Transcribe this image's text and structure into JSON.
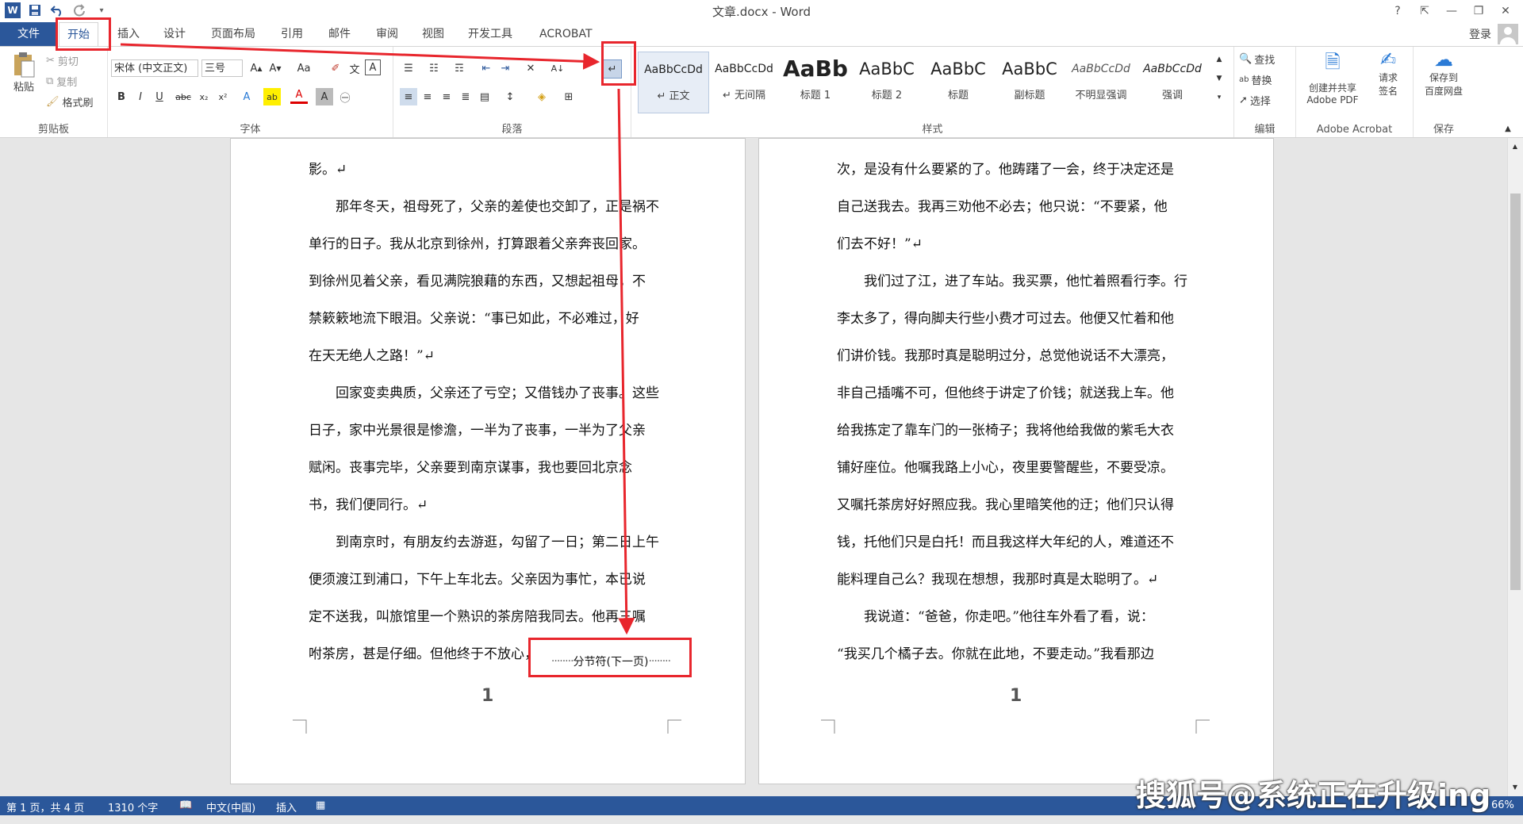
{
  "app": {
    "title": "文章.docx - Word",
    "login": "登录"
  },
  "window_controls": {
    "help": "?",
    "ribbon_display": "⇱",
    "minimize": "—",
    "restore": "❐",
    "close": "✕"
  },
  "tabs": [
    {
      "label": "文件"
    },
    {
      "label": "开始"
    },
    {
      "label": "插入"
    },
    {
      "label": "设计"
    },
    {
      "label": "页面布局"
    },
    {
      "label": "引用"
    },
    {
      "label": "邮件"
    },
    {
      "label": "审阅"
    },
    {
      "label": "视图"
    },
    {
      "label": "开发工具"
    },
    {
      "label": "ACROBAT"
    }
  ],
  "clipboard": {
    "paste": "粘贴",
    "cut": "剪切",
    "copy": "复制",
    "format_painter": "格式刷",
    "label": "剪贴板"
  },
  "font": {
    "name": "宋体 (中文正文)",
    "size": "三号",
    "label": "字体",
    "change_case": "Aa"
  },
  "paragraph": {
    "label": "段落"
  },
  "styles": {
    "label": "样式",
    "items": [
      {
        "preview": "AaBbCcDd",
        "name": "↵ 正文"
      },
      {
        "preview": "AaBbCcDd",
        "name": "↵ 无间隔"
      },
      {
        "preview": "AaBb",
        "name": "标题 1"
      },
      {
        "preview": "AaBbC",
        "name": "标题 2"
      },
      {
        "preview": "AaBbC",
        "name": "标题"
      },
      {
        "preview": "AaBbC",
        "name": "副标题"
      },
      {
        "preview": "AaBbCcDd",
        "name": "不明显强调"
      },
      {
        "preview": "AaBbCcDd",
        "name": "强调"
      }
    ]
  },
  "editing": {
    "find": "查找",
    "replace": "替换",
    "select": "选择",
    "label": "编辑"
  },
  "acrobat": {
    "create_share": "创建并共享",
    "adobe_pdf": "Adobe PDF",
    "request": "请求",
    "sign": "签名",
    "label": "Adobe Acrobat"
  },
  "save": {
    "save_to": "保存到",
    "baidu": "百度网盘",
    "label": "保存"
  },
  "page1": {
    "lines": [
      "影。↵",
      "　　那年冬天，祖母死了，父亲的差使也交卸了，正是祸不",
      "单行的日子。我从北京到徐州，打算跟着父亲奔丧回家。",
      "到徐州见着父亲，看见满院狼藉的东西，又想起祖母，不",
      "禁簌簌地流下眼泪。父亲说：“事已如此，不必难过，好",
      "在天无绝人之路！”↵",
      "　　回家变卖典质，父亲还了亏空；又借钱办了丧事。这些",
      "日子，家中光景很是惨澹，一半为了丧事，一半为了父亲",
      "赋闲。丧事完毕，父亲要到南京谋事，我也要回北京念",
      "书，我们便同行。↵",
      "　　到南京时，有朋友约去游逛，勾留了一日；第二日上午",
      "便须渡江到浦口，下午上车北去。父亲因为事忙，本已说",
      "定不送我，叫旅馆里一个熟识的茶房陪我同去。他再三嘱",
      "咐茶房，甚是仔细。但他终于不放心，"
    ],
    "section_break": "分节符(下一页)",
    "page_number": "1"
  },
  "page2": {
    "lines": [
      "次，是没有什么要紧的了。他踌躇了一会，终于决定还是",
      "自己送我去。我再三劝他不必去；他只说：“不要紧，他",
      "们去不好！”↵",
      "　　我们过了江，进了车站。我买票，他忙着照看行李。行",
      "李太多了，得向脚夫行些小费才可过去。他便又忙着和他",
      "们讲价钱。我那时真是聪明过分，总觉他说话不大漂亮，",
      "非自己插嘴不可，但他终于讲定了价钱；就送我上车。他",
      "给我拣定了靠车门的一张椅子；我将他给我做的紫毛大衣",
      "铺好座位。他嘱我路上小心，夜里要警醒些，不要受凉。",
      "又嘱托茶房好好照应我。我心里暗笑他的迂；他们只认得",
      "钱，托他们只是白托！而且我这样大年纪的人，难道还不",
      "能料理自己么？我现在想想，我那时真是太聪明了。↵",
      "　　我说道：“爸爸，你走吧。”他往车外看了看，说：",
      "“我买几个橘子去。你就在此地，不要走动。”我看那边"
    ],
    "page_number": "1"
  },
  "status": {
    "page": "第 1 页，共 4 页",
    "words": "1310 个字",
    "language": "中文(中国)",
    "mode": "插入",
    "zoom": "66%"
  },
  "watermark": "搜狐号@系统正在升级ing",
  "colors": {
    "accent": "#2b579a",
    "annotation": "#e8262d"
  }
}
